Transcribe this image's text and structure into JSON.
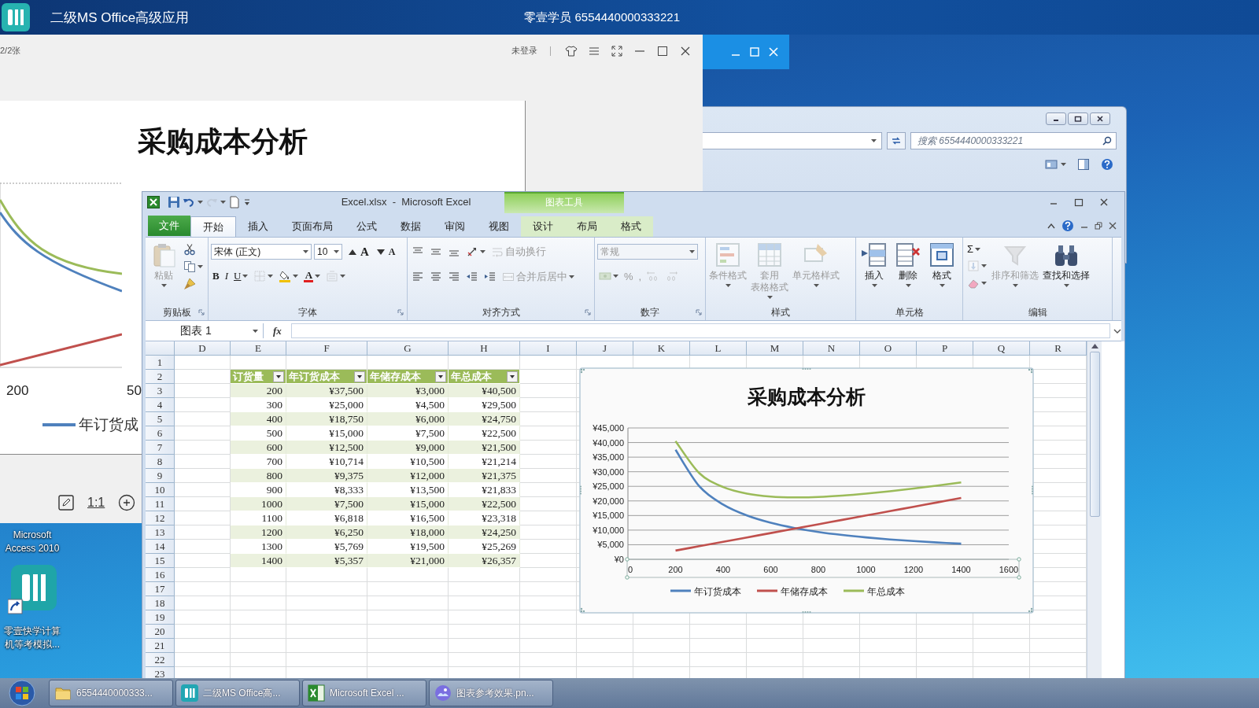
{
  "topbar": {
    "title": "二级MS Office高级应用",
    "user": "零壹学员 6554440000333221"
  },
  "viewer": {
    "page": "2/2张",
    "login": "未登录",
    "image_title": "采购成本分析",
    "image_ticks": [
      "200",
      "50"
    ],
    "image_legend": "年订货成",
    "zoom_label": "1:1"
  },
  "explorer": {
    "search": {
      "placeholder": "搜索 6554440000333221"
    }
  },
  "desktop_icons": [
    {
      "kind": "label",
      "label": "Microsoft Access 2010"
    },
    {
      "kind": "shortcut",
      "label": "零壹快学计算机等考模拟..."
    }
  ],
  "excel": {
    "title": "Excel.xlsx  -  Microsoft Excel",
    "context_title": "图表工具",
    "file_tab": "文件",
    "tabs": [
      {
        "label": "开始",
        "selected": true,
        "context": false
      },
      {
        "label": "插入",
        "selected": false,
        "context": false
      },
      {
        "label": "页面布局",
        "selected": false,
        "context": false
      },
      {
        "label": "公式",
        "selected": false,
        "context": false
      },
      {
        "label": "数据",
        "selected": false,
        "context": false
      },
      {
        "label": "审阅",
        "selected": false,
        "context": false
      },
      {
        "label": "视图",
        "selected": false,
        "context": false
      },
      {
        "label": "设计",
        "selected": false,
        "context": true
      },
      {
        "label": "布局",
        "selected": false,
        "context": true
      },
      {
        "label": "格式",
        "selected": false,
        "context": true
      }
    ],
    "ribbon": {
      "groups": [
        {
          "label": "剪贴板",
          "items": [
            {
              "kind": "large",
              "label": "粘贴",
              "disabled": true
            },
            {
              "kind": "stack",
              "buttons": [
                {
                  "disabled": false
                },
                {
                  "disabled": false
                },
                {
                  "disabled": false
                }
              ]
            }
          ]
        },
        {
          "label": "字体",
          "items": [
            {
              "kind": "rows",
              "rows": [
                {
                  "controls": [
                    {
                      "kind": "combo",
                      "value": "宋体 (正文)",
                      "disabled": false
                    },
                    {
                      "kind": "combo",
                      "value": "10",
                      "disabled": false
                    },
                    {
                      "kind": "button",
                      "label": "A",
                      "disabled": false
                    },
                    {
                      "kind": "button",
                      "label": "A",
                      "disabled": false
                    }
                  ]
                },
                {
                  "controls": [
                    {
                      "kind": "button",
                      "label": "B",
                      "disabled": false
                    },
                    {
                      "kind": "button",
                      "label": "I",
                      "disabled": false
                    },
                    {
                      "kind": "button",
                      "label": "U",
                      "disabled": false
                    },
                    {
                      "kind": "button",
                      "disabled": true
                    },
                    {
                      "kind": "button",
                      "disabled": false
                    },
                    {
                      "kind": "button",
                      "label": "A",
                      "disabled": false
                    },
                    {
                      "kind": "button",
                      "disabled": true
                    }
                  ]
                }
              ]
            }
          ]
        },
        {
          "label": "对齐方式",
          "items": [
            {
              "kind": "rows",
              "rows": [
                {
                  "controls": [
                    {
                      "kind": "button",
                      "disabled": false
                    },
                    {
                      "kind": "button",
                      "disabled": false
                    },
                    {
                      "kind": "button",
                      "disabled": false
                    },
                    {
                      "kind": "button",
                      "disabled": false
                    },
                    {
                      "kind": "button",
                      "label": "自动换行",
                      "disabled": true
                    }
                  ]
                },
                {
                  "controls": [
                    {
                      "kind": "button",
                      "disabled": false
                    },
                    {
                      "kind": "button",
                      "disabled": false
                    },
                    {
                      "kind": "button",
                      "disabled": false
                    },
                    {
                      "kind": "button",
                      "disabled": false
                    },
                    {
                      "kind": "button",
                      "disabled": false
                    },
                    {
                      "kind": "button",
                      "label": "合并后居中",
                      "disabled": true
                    }
                  ]
                }
              ]
            }
          ]
        },
        {
          "label": "数字",
          "items": [
            {
              "kind": "rows",
              "rows": [
                {
                  "controls": [
                    {
                      "kind": "combo",
                      "value": "常规",
                      "disabled": true
                    }
                  ]
                },
                {
                  "controls": [
                    {
                      "kind": "button",
                      "disabled": true
                    },
                    {
                      "kind": "button",
                      "label": "%",
                      "disabled": true
                    },
                    {
                      "kind": "button",
                      "label": ",",
                      "disabled": true
                    },
                    {
                      "kind": "button",
                      "disabled": true
                    },
                    {
                      "kind": "button",
                      "disabled": true
                    }
                  ]
                }
              ]
            }
          ]
        },
        {
          "label": "样式",
          "items": [
            {
              "kind": "large",
              "label": "条件格式",
              "disabled": true
            },
            {
              "kind": "large",
              "label_lines": [
                "套用",
                "表格格式"
              ],
              "disabled": true
            },
            {
              "kind": "large",
              "label": "单元格样式",
              "disabled": true
            }
          ]
        },
        {
          "label": "单元格",
          "items": [
            {
              "kind": "large",
              "label": "插入",
              "disabled": false
            },
            {
              "kind": "large",
              "label": "删除",
              "disabled": false
            },
            {
              "kind": "large",
              "label": "格式",
              "disabled": false
            }
          ]
        },
        {
          "label": "编辑",
          "items": [
            {
              "kind": "stack",
              "buttons": [
                {
                  "label": "Σ",
                  "disabled": false
                },
                {
                  "disabled": true
                },
                {
                  "disabled": false
                }
              ]
            },
            {
              "kind": "large",
              "label": "排序和筛选",
              "disabled": true
            },
            {
              "kind": "large",
              "label": "查找和选择",
              "disabled": false
            }
          ]
        }
      ]
    },
    "formula_bar": {
      "name_box": "图表 1",
      "fx": "fx"
    },
    "sheet": {
      "columns": [
        "D",
        "E",
        "F",
        "G",
        "H",
        "I",
        "J",
        "K",
        "L",
        "M",
        "N",
        "O",
        "P",
        "Q",
        "R"
      ],
      "rows": [
        "1",
        "2",
        "3",
        "4",
        "5",
        "6",
        "7",
        "8",
        "9",
        "10",
        "11",
        "12",
        "13",
        "14",
        "15",
        "16",
        "17",
        "18",
        "19",
        "20",
        "21",
        "22",
        "23"
      ],
      "table": {
        "headers": [
          "订货量",
          "年订货成本",
          "年储存成本",
          "年总成本"
        ],
        "rows": [
          [
            "200",
            "¥37,500",
            "¥3,000",
            "¥40,500"
          ],
          [
            "300",
            "¥25,000",
            "¥4,500",
            "¥29,500"
          ],
          [
            "400",
            "¥18,750",
            "¥6,000",
            "¥24,750"
          ],
          [
            "500",
            "¥15,000",
            "¥7,500",
            "¥22,500"
          ],
          [
            "600",
            "¥12,500",
            "¥9,000",
            "¥21,500"
          ],
          [
            "700",
            "¥10,714",
            "¥10,500",
            "¥21,214"
          ],
          [
            "800",
            "¥9,375",
            "¥12,000",
            "¥21,375"
          ],
          [
            "900",
            "¥8,333",
            "¥13,500",
            "¥21,833"
          ],
          [
            "1000",
            "¥7,500",
            "¥15,000",
            "¥22,500"
          ],
          [
            "1100",
            "¥6,818",
            "¥16,500",
            "¥23,318"
          ],
          [
            "1200",
            "¥6,250",
            "¥18,000",
            "¥24,250"
          ],
          [
            "1300",
            "¥5,769",
            "¥19,500",
            "¥25,269"
          ],
          [
            "1400",
            "¥5,357",
            "¥21,000",
            "¥26,357"
          ]
        ]
      }
    },
    "chart": {
      "chart_data": {
        "type": "line",
        "title": "采购成本分析",
        "grid": true,
        "legend": true,
        "x": [
          200,
          300,
          400,
          500,
          600,
          700,
          800,
          900,
          1000,
          1100,
          1200,
          1300,
          1400
        ],
        "series": [
          {
            "name": "年订货成本",
            "color": "#4f81bd",
            "values": [
              37500,
              25000,
              18750,
              15000,
              12500,
              10714,
              9375,
              8333,
              7500,
              6818,
              6250,
              5769,
              5357
            ]
          },
          {
            "name": "年储存成本",
            "color": "#c0504d",
            "values": [
              3000,
              4500,
              6000,
              7500,
              9000,
              10500,
              12000,
              13500,
              15000,
              16500,
              18000,
              19500,
              21000
            ]
          },
          {
            "name": "年总成本",
            "color": "#9bbb59",
            "values": [
              40500,
              29500,
              24750,
              22500,
              21500,
              21214,
              21375,
              21833,
              22500,
              23318,
              24250,
              25269,
              26357
            ]
          }
        ],
        "xlim": [
          0,
          1600
        ],
        "ylim": [
          0,
          45000
        ],
        "xticks": [
          {
            "value": 0,
            "label": "0"
          },
          {
            "value": 200,
            "label": "200"
          },
          {
            "value": 400,
            "label": "400"
          },
          {
            "value": 600,
            "label": "600"
          },
          {
            "value": 800,
            "label": "800"
          },
          {
            "value": 1000,
            "label": "1000"
          },
          {
            "value": 1200,
            "label": "1200"
          },
          {
            "value": 1400,
            "label": "1400"
          },
          {
            "value": 1600,
            "label": "1600"
          }
        ],
        "yticks": [
          {
            "value": 0,
            "label": "¥0"
          },
          {
            "value": 5000,
            "label": "¥5,000"
          },
          {
            "value": 10000,
            "label": "¥10,000"
          },
          {
            "value": 15000,
            "label": "¥15,000"
          },
          {
            "value": 20000,
            "label": "¥20,000"
          },
          {
            "value": 25000,
            "label": "¥25,000"
          },
          {
            "value": 30000,
            "label": "¥30,000"
          },
          {
            "value": 35000,
            "label": "¥35,000"
          },
          {
            "value": 40000,
            "label": "¥40,000"
          },
          {
            "value": 45000,
            "label": "¥45,000"
          }
        ]
      }
    }
  },
  "taskbar": {
    "tasks": [
      {
        "kind": "folder",
        "label": "6554440000333..."
      },
      {
        "kind": "app",
        "label": "二级MS Office高..."
      },
      {
        "kind": "excel",
        "label": "Microsoft Excel ..."
      },
      {
        "kind": "image",
        "label": "图表参考效果.pn..."
      }
    ]
  }
}
